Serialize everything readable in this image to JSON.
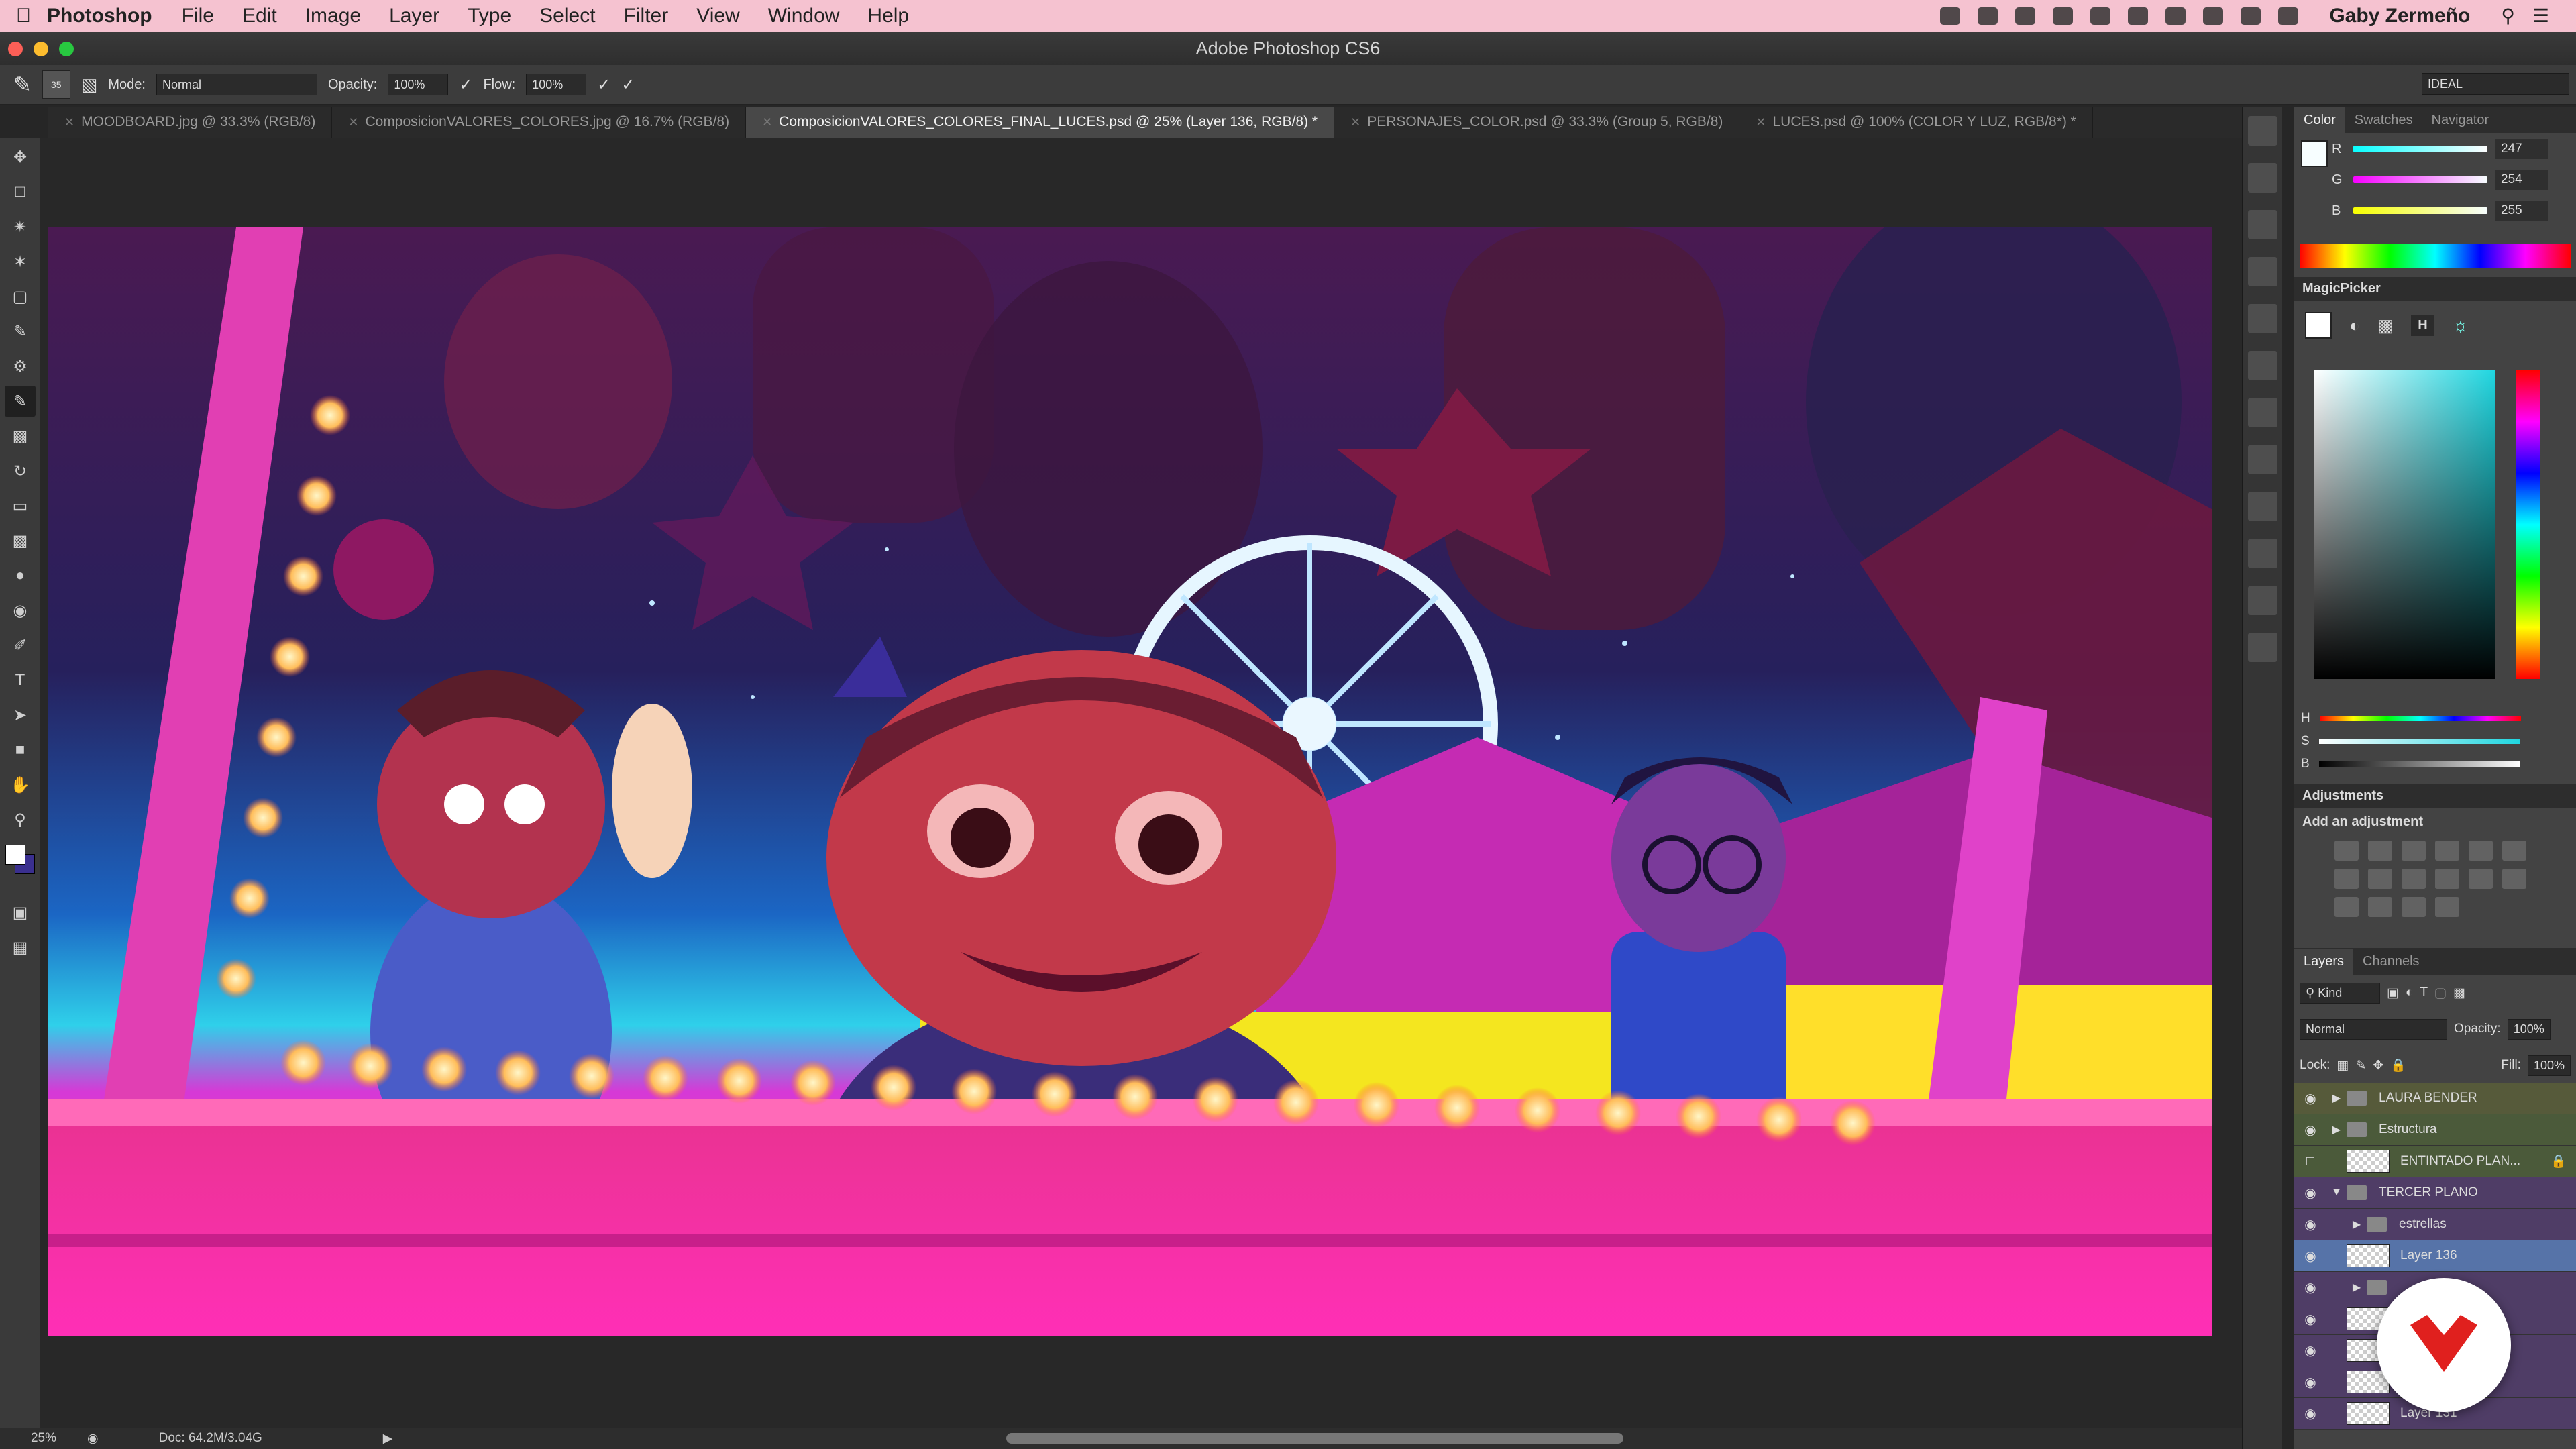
{
  "menubar": {
    "app": "Photoshop",
    "items": [
      "File",
      "Edit",
      "Image",
      "Layer",
      "Type",
      "Select",
      "Filter",
      "View",
      "Window",
      "Help"
    ],
    "user": "Gaby Zermeño"
  },
  "window": {
    "title": "Adobe Photoshop CS6"
  },
  "options": {
    "brush_size": "35",
    "mode_label": "Mode:",
    "mode_value": "Normal",
    "opacity_label": "Opacity:",
    "opacity_value": "100%",
    "flow_label": "Flow:",
    "flow_value": "100%",
    "workspace": "IDEAL"
  },
  "tabs": [
    {
      "label": "MOODBOARD.jpg @ 33.3% (RGB/8)"
    },
    {
      "label": "ComposicionVALORES_COLORES.jpg @ 16.7% (RGB/8)"
    },
    {
      "label": "ComposicionVALORES_COLORES_FINAL_LUCES.psd @ 25% (Layer 136, RGB/8) *"
    },
    {
      "label": "PERSONAJES_COLOR.psd @ 33.3% (Group 5, RGB/8)"
    },
    {
      "label": "LUCES.psd @ 100% (COLOR Y LUZ, RGB/8*) *"
    }
  ],
  "status": {
    "zoom": "25%",
    "doc": "Doc: 64.2M/3.04G"
  },
  "color_panel": {
    "tabs": [
      "Color",
      "Swatches",
      "Navigator"
    ],
    "r_label": "R",
    "r_value": "247",
    "g_label": "G",
    "g_value": "254",
    "b_label": "B",
    "b_value": "255"
  },
  "magicpicker": {
    "title": "MagicPicker",
    "h_btn": "H",
    "h_label": "H",
    "s_label": "S",
    "b_label": "B"
  },
  "adjustments": {
    "title": "Adjustments",
    "subtitle": "Add an adjustment"
  },
  "layers_panel": {
    "tabs": [
      "Layers",
      "Channels"
    ],
    "kind": "Kind",
    "blend": "Normal",
    "opacity_label": "Opacity:",
    "opacity_value": "100%",
    "lock_label": "Lock:",
    "fill_label": "Fill:",
    "fill_value": "100%",
    "layers": [
      {
        "name": "LAURA BENDER"
      },
      {
        "name": "Estructura"
      },
      {
        "name": "ENTINTADO PLAN..."
      },
      {
        "name": "TERCER PLANO"
      },
      {
        "name": "estrellas"
      },
      {
        "name": "Layer 136"
      },
      {
        "name": "Layer 131"
      }
    ]
  },
  "colors": {
    "canvas_bg": "#282828",
    "accent_selected": "#5673a8",
    "menubar_bg": "#f5c2d0",
    "logo_red": "#e0201e"
  }
}
